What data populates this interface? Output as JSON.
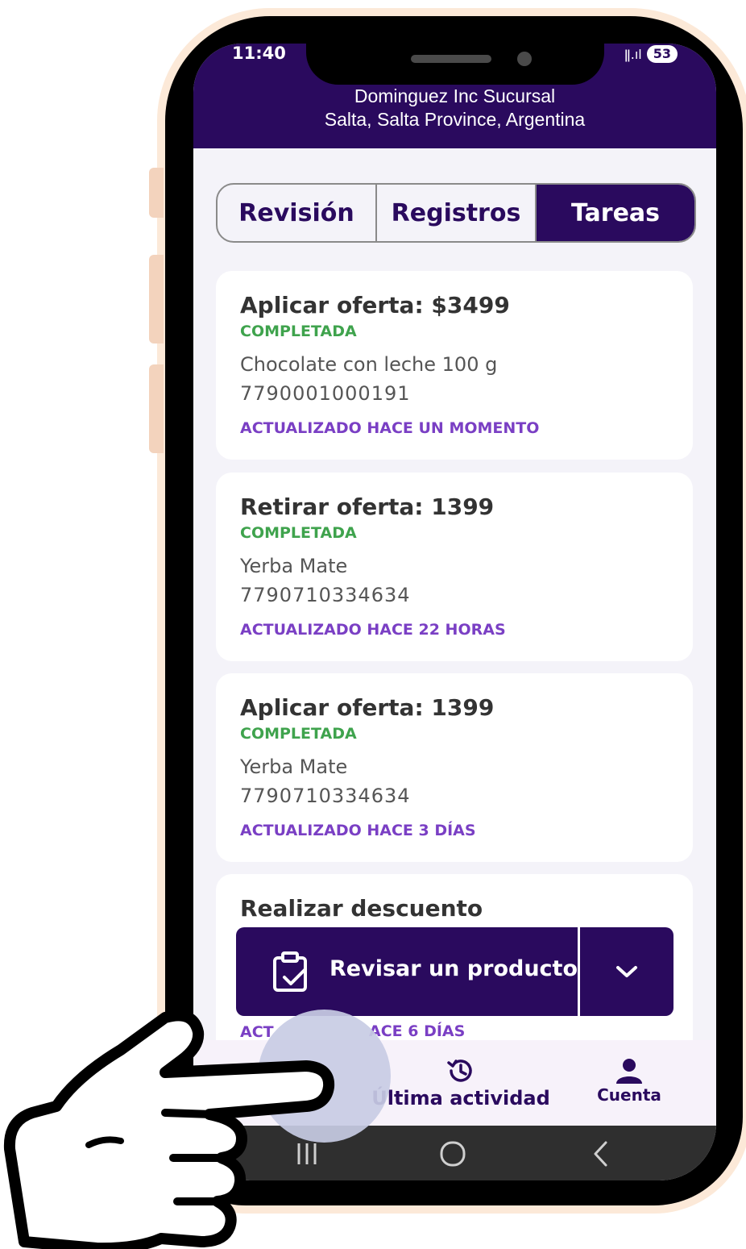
{
  "status_bar": {
    "time": "11:40",
    "battery": "53"
  },
  "header": {
    "line1": "Dominguez Inc Sucursal",
    "line2": "Salta, Salta Province, Argentina"
  },
  "tabs": [
    {
      "label": "Revisión"
    },
    {
      "label": "Registros"
    },
    {
      "label": "Tareas"
    }
  ],
  "cards": [
    {
      "title": "Aplicar oferta: $3499",
      "status": "COMPLETADA",
      "product": "Chocolate con leche 100 g",
      "code": "7790001000191",
      "updated": "ACTUALIZADO HACE UN MOMENTO"
    },
    {
      "title": "Retirar oferta: 1399",
      "status": "COMPLETADA",
      "product": "Yerba Mate",
      "code": "7790710334634",
      "updated": "ACTUALIZADO HACE 22 HORAS"
    },
    {
      "title": "Aplicar oferta: 1399",
      "status": "COMPLETADA",
      "product": "Yerba Mate",
      "code": "7790710334634",
      "updated": "ACTUALIZADO HACE 3 DÍAS"
    },
    {
      "title": "Realizar descuento",
      "updated": "ACT"
    }
  ],
  "peek_updated_tail": "ACE 6 DÍAS",
  "fab": {
    "label": "Revisar un producto"
  },
  "bottom_nav": {
    "activity": "Última actividad",
    "account": "Cuenta"
  },
  "colors": {
    "primary": "#2a0a5e",
    "status_green": "#3fa34d",
    "updated_purple": "#7a3fc4"
  },
  "icons": [
    "clipboard-check-icon",
    "chevron-down-icon",
    "history-icon",
    "person-icon",
    "menu-lines-icon",
    "home-circle-icon",
    "back-chevron-icon",
    "pointing-hand-icon"
  ]
}
